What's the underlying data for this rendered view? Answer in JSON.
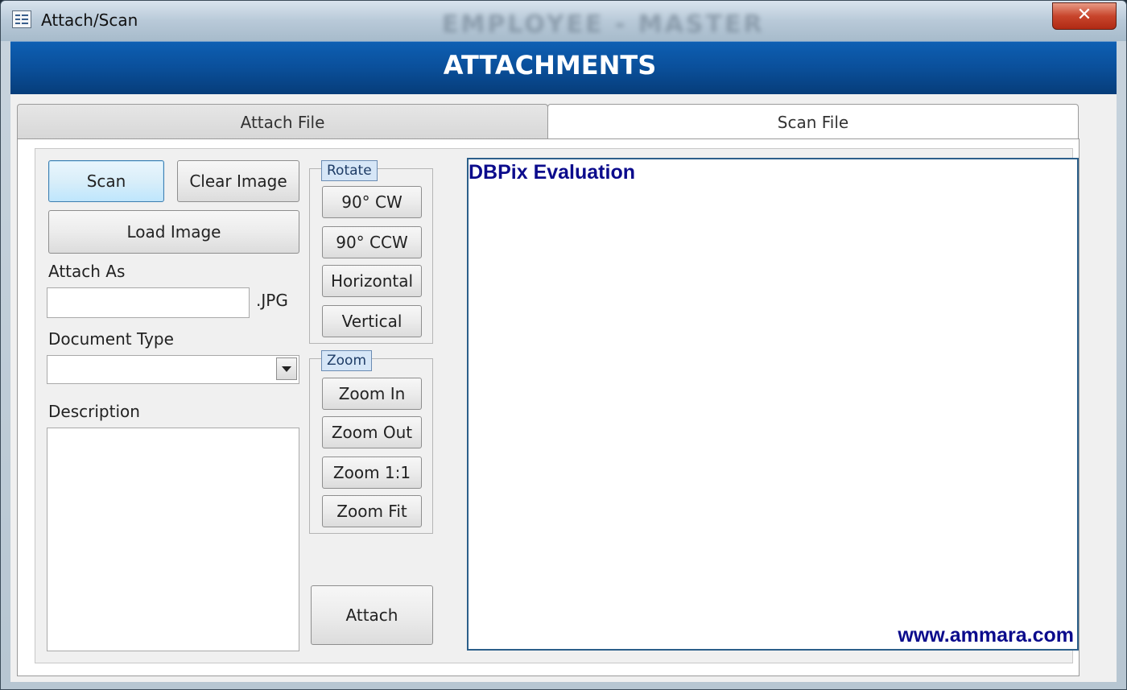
{
  "window": {
    "title": "Attach/Scan",
    "background_title": "EMPLOYEE - MASTER",
    "close_label": "✕"
  },
  "banner": {
    "title": "ATTACHMENTS"
  },
  "tabs": [
    {
      "label": "Attach File",
      "selected": false
    },
    {
      "label": "Scan File",
      "selected": true
    }
  ],
  "actions": {
    "scan": "Scan",
    "clear_image": "Clear Image",
    "load_image": "Load Image",
    "attach": "Attach"
  },
  "fields": {
    "attach_as_label": "Attach As",
    "attach_as_value": "",
    "attach_as_ext": ".JPG",
    "document_type_label": "Document Type",
    "document_type_value": "",
    "description_label": "Description",
    "description_value": ""
  },
  "rotate": {
    "label": "Rotate",
    "buttons": [
      "90° CW",
      "90° CCW",
      "Horizontal",
      "Vertical"
    ]
  },
  "zoom": {
    "label": "Zoom",
    "buttons": [
      "Zoom In",
      "Zoom Out",
      "Zoom 1:1",
      "Zoom Fit"
    ]
  },
  "viewer": {
    "title": "DBPix Evaluation",
    "url": "www.ammara.com"
  },
  "colors": {
    "banner": "#0a4f9a",
    "viewer_text": "#0b0b8c"
  }
}
